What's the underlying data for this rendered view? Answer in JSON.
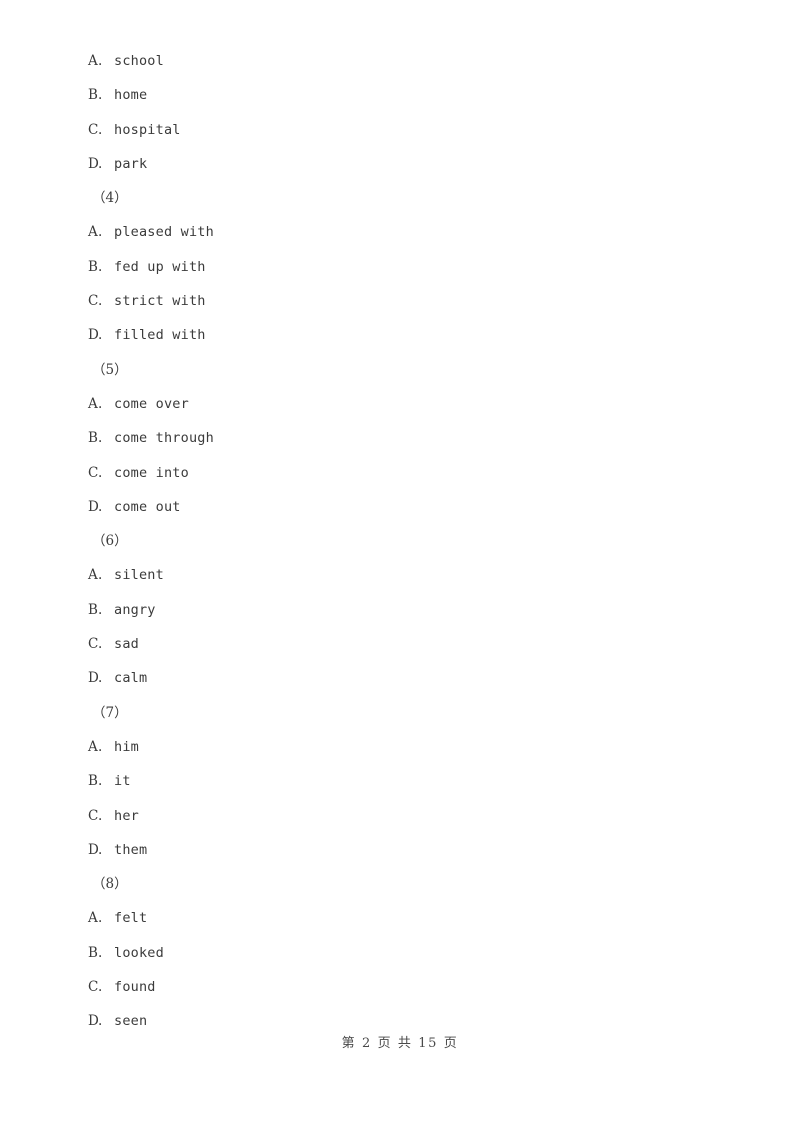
{
  "document": {
    "type": "exam-worksheet",
    "language": "zh-CN",
    "background_color": "#ffffff",
    "text_color": "#3b3b3b"
  },
  "blocks": [
    {
      "question_label": null,
      "options": [
        {
          "letter": "A",
          "separator": ".",
          "text": "school"
        },
        {
          "letter": "B",
          "separator": ".",
          "text": "home"
        },
        {
          "letter": "C",
          "separator": ".",
          "text": "hospital"
        },
        {
          "letter": "D",
          "separator": ".",
          "text": "park"
        }
      ]
    },
    {
      "question_label": "（4）",
      "options": [
        {
          "letter": "A",
          "separator": ".",
          "text": "pleased with"
        },
        {
          "letter": "B",
          "separator": ".",
          "text": "fed up with"
        },
        {
          "letter": "C",
          "separator": ".",
          "text": "strict with"
        },
        {
          "letter": "D",
          "separator": ".",
          "text": "filled with"
        }
      ]
    },
    {
      "question_label": "（5）",
      "options": [
        {
          "letter": "A",
          "separator": ".",
          "text": "come over"
        },
        {
          "letter": "B",
          "separator": ".",
          "text": "come through"
        },
        {
          "letter": "C",
          "separator": ".",
          "text": "come into"
        },
        {
          "letter": "D",
          "separator": ".",
          "text": "come out"
        }
      ]
    },
    {
      "question_label": "（6）",
      "options": [
        {
          "letter": "A",
          "separator": ".",
          "text": "silent"
        },
        {
          "letter": "B",
          "separator": ".",
          "text": "angry"
        },
        {
          "letter": "C",
          "separator": ".",
          "text": "sad"
        },
        {
          "letter": "D",
          "separator": ".",
          "text": "calm"
        }
      ]
    },
    {
      "question_label": "（7）",
      "options": [
        {
          "letter": "A",
          "separator": ".",
          "text": "him"
        },
        {
          "letter": "B",
          "separator": ".",
          "text": "it"
        },
        {
          "letter": "C",
          "separator": ".",
          "text": "her"
        },
        {
          "letter": "D",
          "separator": ".",
          "text": "them"
        }
      ]
    },
    {
      "question_label": "（8）",
      "options": [
        {
          "letter": "A",
          "separator": ".",
          "text": "felt"
        },
        {
          "letter": "B",
          "separator": ".",
          "text": "looked"
        },
        {
          "letter": "C",
          "separator": ".",
          "text": "found"
        },
        {
          "letter": "D",
          "separator": ".",
          "text": "seen"
        }
      ]
    }
  ],
  "footer": {
    "text": "第 2 页 共 15 页",
    "current_page": "2",
    "total_pages": "15"
  }
}
